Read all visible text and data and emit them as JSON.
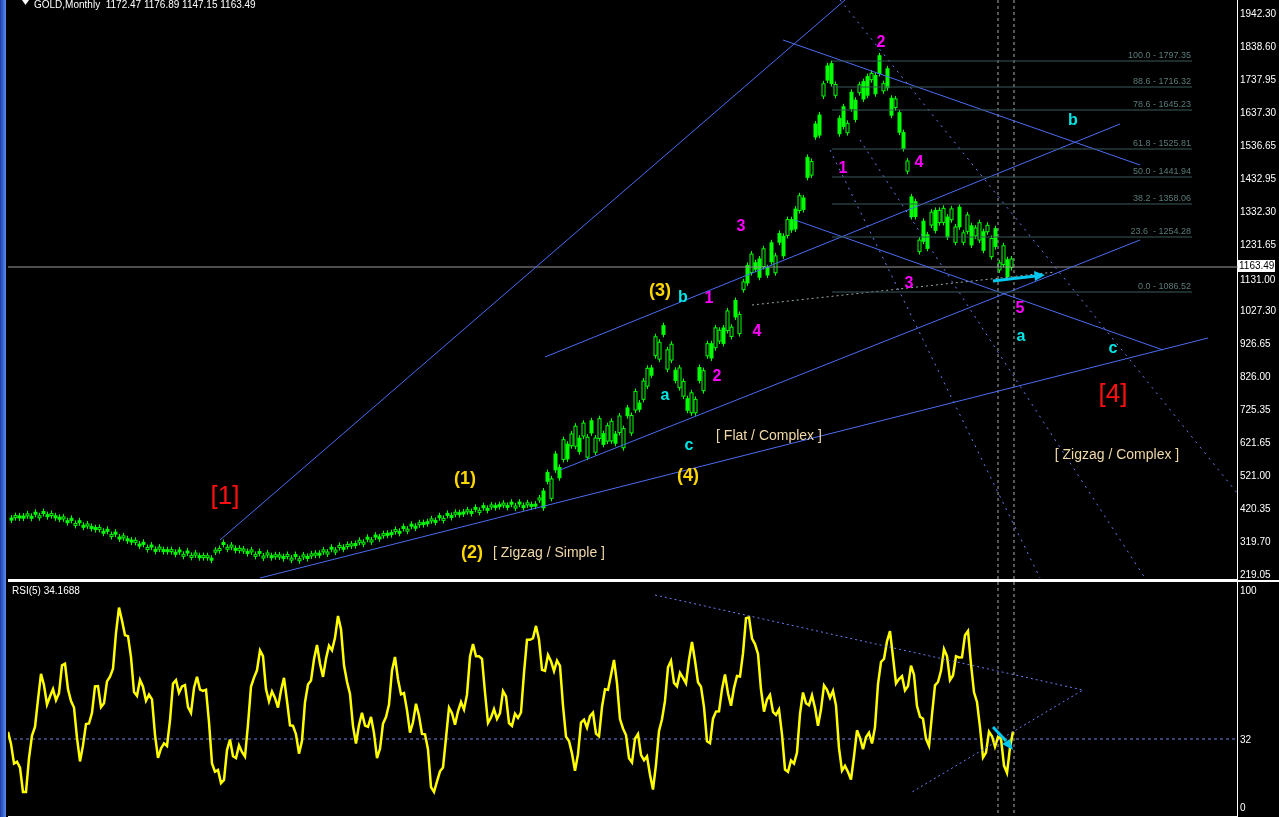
{
  "chart": {
    "header": {
      "symbol": "GOLD,Monthly",
      "ohlc": "1172.47 1176.89 1147.15 1163.49"
    },
    "price_axis": [
      "1942.30",
      "1838.60",
      "1737.95",
      "1637.30",
      "1536.65",
      "1432.95",
      "1332.30",
      "1231.65",
      "1131.00",
      "1027.30",
      "926.65",
      "826.00",
      "725.35",
      "621.65",
      "521.00",
      "420.35",
      "319.70",
      "219.05"
    ],
    "current_price": "1163.49",
    "fib_levels": [
      "100.0 - 1797.35",
      "88.6 - 1716.32",
      "78.6 - 1645.23",
      "61.8 - 1525.81",
      "50.0 - 1441.94",
      "38.2 - 1358.06",
      "23.6  - 1254.28",
      "0.0 - 1086.52"
    ],
    "wave_labels": [
      {
        "text": "2",
        "kind": "minor"
      },
      {
        "text": "1",
        "kind": "minor"
      },
      {
        "text": "4",
        "kind": "minor"
      },
      {
        "text": "3",
        "kind": "minor"
      },
      {
        "text": "1",
        "kind": "minor"
      },
      {
        "text": "4",
        "kind": "minor"
      },
      {
        "text": "2",
        "kind": "minor"
      },
      {
        "text": "3",
        "kind": "minor"
      },
      {
        "text": "5",
        "kind": "minor"
      },
      {
        "text": "(3)",
        "kind": "intermediate"
      },
      {
        "text": "b",
        "kind": "letter"
      },
      {
        "text": "a",
        "kind": "letter"
      },
      {
        "text": "c",
        "kind": "letter"
      },
      {
        "text": "(4)",
        "kind": "intermediate"
      },
      {
        "text": "(1)",
        "kind": "intermediate"
      },
      {
        "text": "(2)",
        "kind": "intermediate"
      },
      {
        "text": "[1]",
        "kind": "primary"
      },
      {
        "text": "[4]",
        "kind": "primary"
      },
      {
        "text": "b",
        "kind": "letter"
      },
      {
        "text": "a",
        "kind": "letter"
      },
      {
        "text": "c",
        "kind": "letter"
      }
    ],
    "pattern_labels": [
      "[ Flat / Complex ]",
      "[ Zigzag / Simple ]",
      "[ Zigzag / Complex ]"
    ]
  },
  "rsi": {
    "title": "RSI(5) 34.1688",
    "axis": [
      "100",
      "32",
      "0"
    ]
  }
}
